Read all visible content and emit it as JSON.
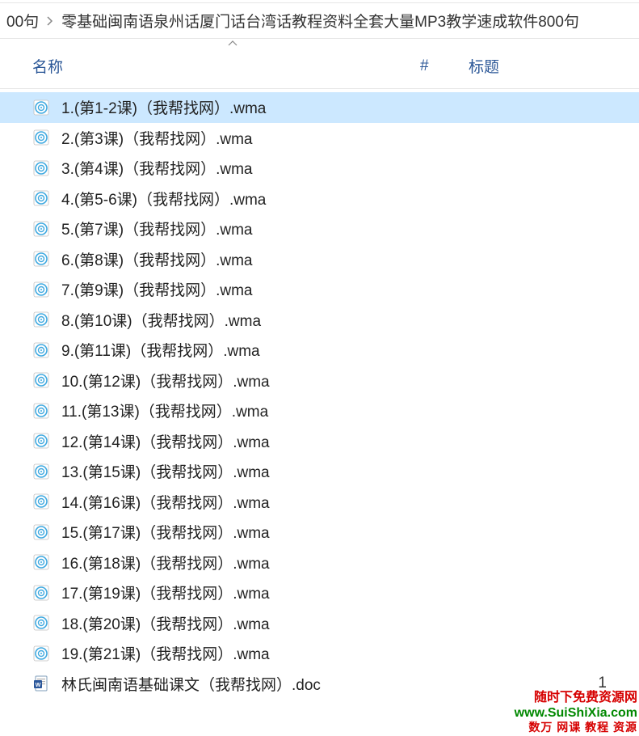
{
  "breadcrumb": {
    "item1": "00句",
    "item2": "零基础闽南语泉州话厦门话台湾话教程资料全套大量MP3教学速成软件800句"
  },
  "columns": {
    "name": "名称",
    "num": "#",
    "title": "标题"
  },
  "files": [
    {
      "name": "1.(第1-2课)（我帮找网）.wma",
      "type": "wma",
      "selected": true
    },
    {
      "name": "2.(第3课)（我帮找网）.wma",
      "type": "wma",
      "selected": false
    },
    {
      "name": "3.(第4课)（我帮找网）.wma",
      "type": "wma",
      "selected": false
    },
    {
      "name": "4.(第5-6课)（我帮找网）.wma",
      "type": "wma",
      "selected": false
    },
    {
      "name": "5.(第7课)（我帮找网）.wma",
      "type": "wma",
      "selected": false
    },
    {
      "name": "6.(第8课)（我帮找网）.wma",
      "type": "wma",
      "selected": false
    },
    {
      "name": "7.(第9课)（我帮找网）.wma",
      "type": "wma",
      "selected": false
    },
    {
      "name": "8.(第10课)（我帮找网）.wma",
      "type": "wma",
      "selected": false
    },
    {
      "name": "9.(第11课)（我帮找网）.wma",
      "type": "wma",
      "selected": false
    },
    {
      "name": "10.(第12课)（我帮找网）.wma",
      "type": "wma",
      "selected": false
    },
    {
      "name": "11.(第13课)（我帮找网）.wma",
      "type": "wma",
      "selected": false
    },
    {
      "name": "12.(第14课)（我帮找网）.wma",
      "type": "wma",
      "selected": false
    },
    {
      "name": "13.(第15课)（我帮找网）.wma",
      "type": "wma",
      "selected": false
    },
    {
      "name": "14.(第16课)（我帮找网）.wma",
      "type": "wma",
      "selected": false
    },
    {
      "name": "15.(第17课)（我帮找网）.wma",
      "type": "wma",
      "selected": false
    },
    {
      "name": "16.(第18课)（我帮找网）.wma",
      "type": "wma",
      "selected": false
    },
    {
      "name": "17.(第19课)（我帮找网）.wma",
      "type": "wma",
      "selected": false
    },
    {
      "name": "18.(第20课)（我帮找网）.wma",
      "type": "wma",
      "selected": false
    },
    {
      "name": "19.(第21课)（我帮找网）.wma",
      "type": "wma",
      "selected": false
    },
    {
      "name": "林氏闽南语基础课文（我帮找网）.doc",
      "type": "doc",
      "selected": false,
      "num": "1"
    }
  ],
  "watermark": {
    "line1": "随时下免费资源网",
    "line2": "www.SuiShiXia.com",
    "line3": "数万 网课 教程 资源"
  }
}
